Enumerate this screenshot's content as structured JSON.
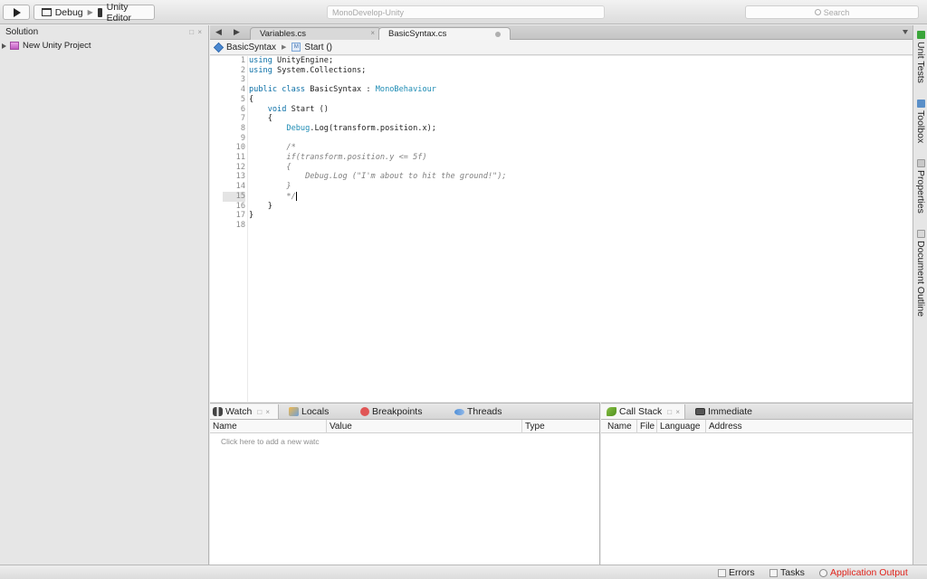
{
  "toolbar": {
    "configuration": "Debug",
    "target": "Unity Editor",
    "status": "MonoDevelop-Unity",
    "search_placeholder": "Search"
  },
  "solution_pad": {
    "title": "Solution",
    "controls": "□ ×",
    "project": "New Unity Project"
  },
  "tabs": [
    {
      "label": "Variables.cs",
      "close": "×"
    },
    {
      "label": "BasicSyntax.cs"
    }
  ],
  "breadcrumb": {
    "class_name": "BasicSyntax",
    "method_name": "Start ()"
  },
  "code_lines": [
    {
      "num": "1",
      "text": "using UnityEngine;"
    },
    {
      "num": "2",
      "text": "using System.Collections;"
    },
    {
      "num": "3",
      "text": ""
    },
    {
      "num": "4",
      "text": "public class BasicSyntax : MonoBehaviour"
    },
    {
      "num": "5",
      "text": "{"
    },
    {
      "num": "6",
      "text": "    void Start ()"
    },
    {
      "num": "7",
      "text": "    {"
    },
    {
      "num": "8",
      "text": "        Debug.Log(transform.position.x);"
    },
    {
      "num": "9",
      "text": ""
    },
    {
      "num": "10",
      "text": "        /*"
    },
    {
      "num": "11",
      "text": "        if(transform.position.y <= 5f)"
    },
    {
      "num": "12",
      "text": "        {"
    },
    {
      "num": "13",
      "text": "            Debug.Log (\"I'm about to hit the ground!\");"
    },
    {
      "num": "14",
      "text": "        }"
    },
    {
      "num": "15",
      "text": "        */"
    },
    {
      "num": "16",
      "text": "    }"
    },
    {
      "num": "17",
      "text": "}"
    },
    {
      "num": "18",
      "text": ""
    }
  ],
  "right_dock": [
    "Unit Tests",
    "Toolbox",
    "Properties",
    "Document Outline"
  ],
  "debug_pad": {
    "tabs": [
      "Watch",
      "Locals",
      "Breakpoints",
      "Threads"
    ],
    "active_controls": "□ ×",
    "columns": [
      "Name",
      "Value",
      "Type"
    ],
    "add_watch": "Click here to add a new watc"
  },
  "callstack_pad": {
    "tabs": [
      "Call Stack",
      "Immediate"
    ],
    "active_controls": "□ ×",
    "columns": [
      "Name",
      "File",
      "Language",
      "Address"
    ]
  },
  "statusbar": {
    "errors": "Errors",
    "tasks": "Tasks",
    "app_output": "Application Output"
  },
  "colors": {
    "keyword": "#0a6fa6",
    "type": "#1e8cb4",
    "comment": "#7f7f7f",
    "app_output": "#e0241c"
  }
}
